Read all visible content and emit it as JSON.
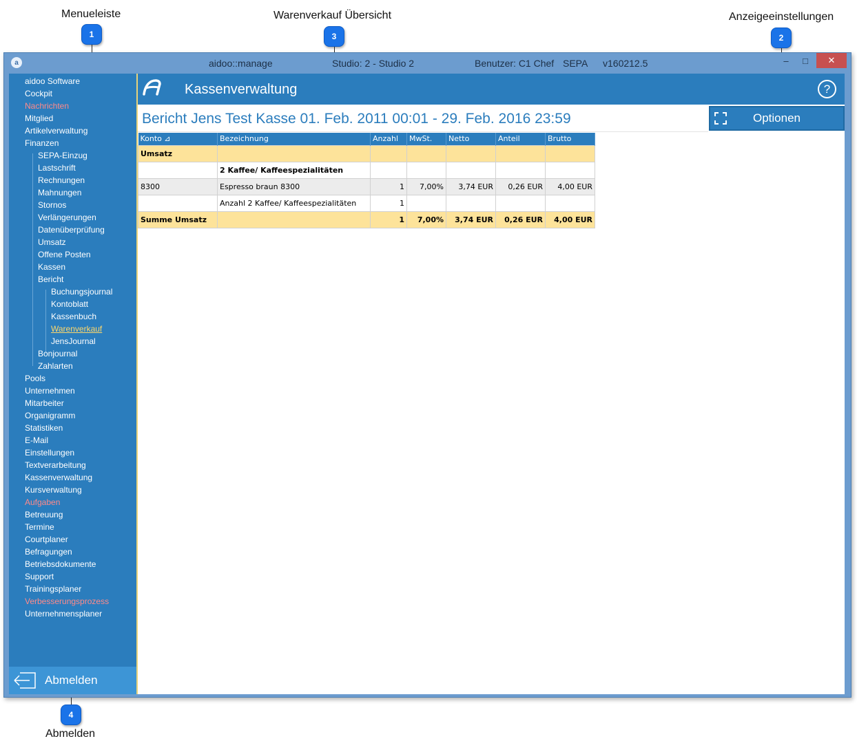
{
  "annotations": {
    "menu": {
      "label": "Menueleiste",
      "number": "1"
    },
    "overview": {
      "label": "Warenverkauf Übersicht",
      "number": "3"
    },
    "display": {
      "label": "Anzeigeeinstellungen",
      "number": "2"
    },
    "logout": {
      "label": "Abmelden",
      "number": "4"
    }
  },
  "titlebar": {
    "app": "aidoo::manage",
    "studio": "Studio: 2 - Studio 2",
    "user": "Benutzer: C1 Chef",
    "mode": "SEPA",
    "version": "v160212.5",
    "minimize": "–",
    "maximize": "□",
    "close": "✕"
  },
  "sidebar": {
    "items": [
      {
        "label": "aidoo Software",
        "level": 0
      },
      {
        "label": "Cockpit",
        "level": 0
      },
      {
        "label": "Nachrichten",
        "level": 0,
        "style": "red"
      },
      {
        "label": "Mitglied",
        "level": 0
      },
      {
        "label": "Artikelverwaltung",
        "level": 0
      },
      {
        "label": "Finanzen",
        "level": 0
      },
      {
        "label": "SEPA-Einzug",
        "level": 1
      },
      {
        "label": "Lastschrift",
        "level": 1
      },
      {
        "label": "Rechnungen",
        "level": 1
      },
      {
        "label": "Mahnungen",
        "level": 1
      },
      {
        "label": "Stornos",
        "level": 1
      },
      {
        "label": "Verlängerungen",
        "level": 1
      },
      {
        "label": "Datenüberprüfung",
        "level": 1
      },
      {
        "label": "Umsatz",
        "level": 1
      },
      {
        "label": "Offene Posten",
        "level": 1
      },
      {
        "label": "Kassen",
        "level": 1
      },
      {
        "label": "Bericht",
        "level": 1
      },
      {
        "label": "Buchungsjournal",
        "level": 2
      },
      {
        "label": "Kontoblatt",
        "level": 2
      },
      {
        "label": "Kassenbuch",
        "level": 2
      },
      {
        "label": "Warenverkauf",
        "level": 2,
        "style": "active"
      },
      {
        "label": "JensJournal",
        "level": 2
      },
      {
        "label": "Bonjournal",
        "level": 1
      },
      {
        "label": "Zahlarten",
        "level": 1
      },
      {
        "label": "Pools",
        "level": 0
      },
      {
        "label": "Unternehmen",
        "level": 0
      },
      {
        "label": "Mitarbeiter",
        "level": 0
      },
      {
        "label": "Organigramm",
        "level": 0
      },
      {
        "label": "Statistiken",
        "level": 0
      },
      {
        "label": "E-Mail",
        "level": 0
      },
      {
        "label": "Einstellungen",
        "level": 0
      },
      {
        "label": "Textverarbeitung",
        "level": 0
      },
      {
        "label": "Kassenverwaltung",
        "level": 0
      },
      {
        "label": "Kursverwaltung",
        "level": 0
      },
      {
        "label": "Aufgaben",
        "level": 0,
        "style": "red"
      },
      {
        "label": "Betreuung",
        "level": 0
      },
      {
        "label": "Termine",
        "level": 0
      },
      {
        "label": "Courtplaner",
        "level": 0
      },
      {
        "label": "Befragungen",
        "level": 0
      },
      {
        "label": "Betriebsdokumente",
        "level": 0
      },
      {
        "label": "Support",
        "level": 0
      },
      {
        "label": "Trainingsplaner",
        "level": 0
      },
      {
        "label": "Verbesserungsprozess",
        "level": 0,
        "style": "red"
      },
      {
        "label": "Unternehmensplaner",
        "level": 0
      }
    ],
    "logout_label": "Abmelden"
  },
  "header": {
    "title": "Kassenverwaltung",
    "help": "?"
  },
  "report": {
    "title": "Bericht Jens Test Kasse 01. Feb. 2011 00:01 - 29. Feb. 2016 23:59",
    "options_label": "Optionen",
    "columns": [
      "Konto ⊿",
      "Bezeichnung",
      "Anzahl",
      "MwSt.",
      "Netto",
      "Anteil",
      "Brutto"
    ],
    "rows": [
      {
        "type": "group",
        "cells": [
          "Umsatz",
          "",
          "",
          "",
          "",
          "",
          ""
        ]
      },
      {
        "type": "sub",
        "cells": [
          "",
          "2 Kaffee/ Kaffeespezialitäten",
          "",
          "",
          "",
          "",
          ""
        ]
      },
      {
        "type": "row",
        "cells": [
          "8300",
          "Espresso braun 8300",
          "1",
          "7,00%",
          "3,74 EUR",
          "0,26 EUR",
          "4,00 EUR"
        ]
      },
      {
        "type": "count",
        "cells": [
          "",
          "Anzahl 2 Kaffee/ Kaffeespezialitäten",
          "1",
          "",
          "",
          "",
          ""
        ]
      },
      {
        "type": "sum",
        "cells": [
          "Summe Umsatz",
          "",
          "1",
          "7,00%",
          "3,74 EUR",
          "0,26 EUR",
          "4,00 EUR"
        ]
      }
    ]
  },
  "colors": {
    "accent": "#2b7dbd",
    "highlight": "#fde39a",
    "alert_text": "#ff8a8a",
    "active_link": "#ffd86b"
  }
}
